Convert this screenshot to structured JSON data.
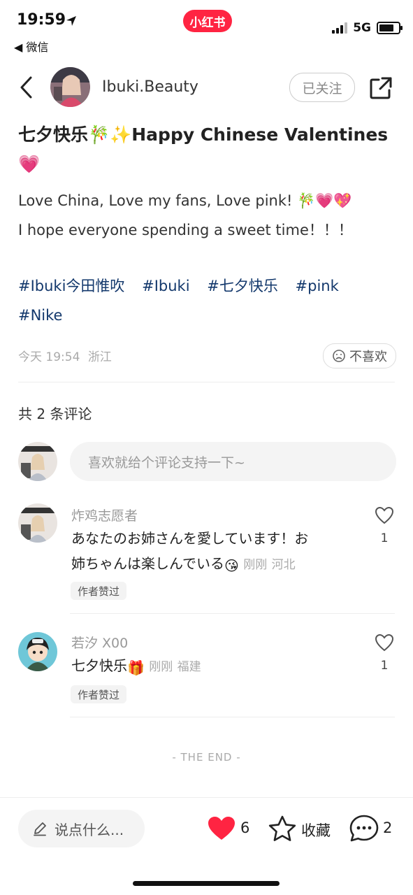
{
  "status_bar": {
    "time": "19:59",
    "back_app": "◀ 微信",
    "app_badge": "小红书",
    "network": "5G"
  },
  "author": {
    "name": "Ibuki.Beauty",
    "follow_label": "已关注"
  },
  "post": {
    "title": "七夕快乐🎋✨Happy Chinese Valentines💗",
    "body_lines": [
      "Love China, Love my fans, Love pink! 🎋💗💖",
      "I hope everyone spending a sweet time！！！"
    ],
    "tags": [
      "#Ibuki今田惟吹",
      "#Ibuki",
      "#七夕快乐",
      "#pink",
      "#Nike"
    ],
    "date": "今天 19:54",
    "location": "浙江",
    "dislike_label": "不喜欢"
  },
  "comments_header": "共 2 条评论",
  "comment_input_placeholder": "喜欢就给个评论支持一下~",
  "comments": [
    {
      "user": "炸鸡志愿者",
      "text_line1": "あなたのお姉さんを愛しています！お",
      "text_line2": "姉ちゃんは楽しんでいる",
      "emoji": "😘",
      "time": "刚刚",
      "location": "河北",
      "likes": "1",
      "badge": "作者赞过"
    },
    {
      "user": "若汐 X00",
      "text_line1": "七夕快乐",
      "emoji": "🎁",
      "time": "刚刚",
      "location": "福建",
      "likes": "1",
      "badge": "作者赞过"
    }
  ],
  "end_label": "- THE END -",
  "bottom_bar": {
    "input_placeholder": "说点什么...",
    "like_count": "6",
    "collect_label": "收藏",
    "comment_count": "2"
  },
  "colors": {
    "brand_red": "#ff2442",
    "tag_blue": "#13386c"
  }
}
